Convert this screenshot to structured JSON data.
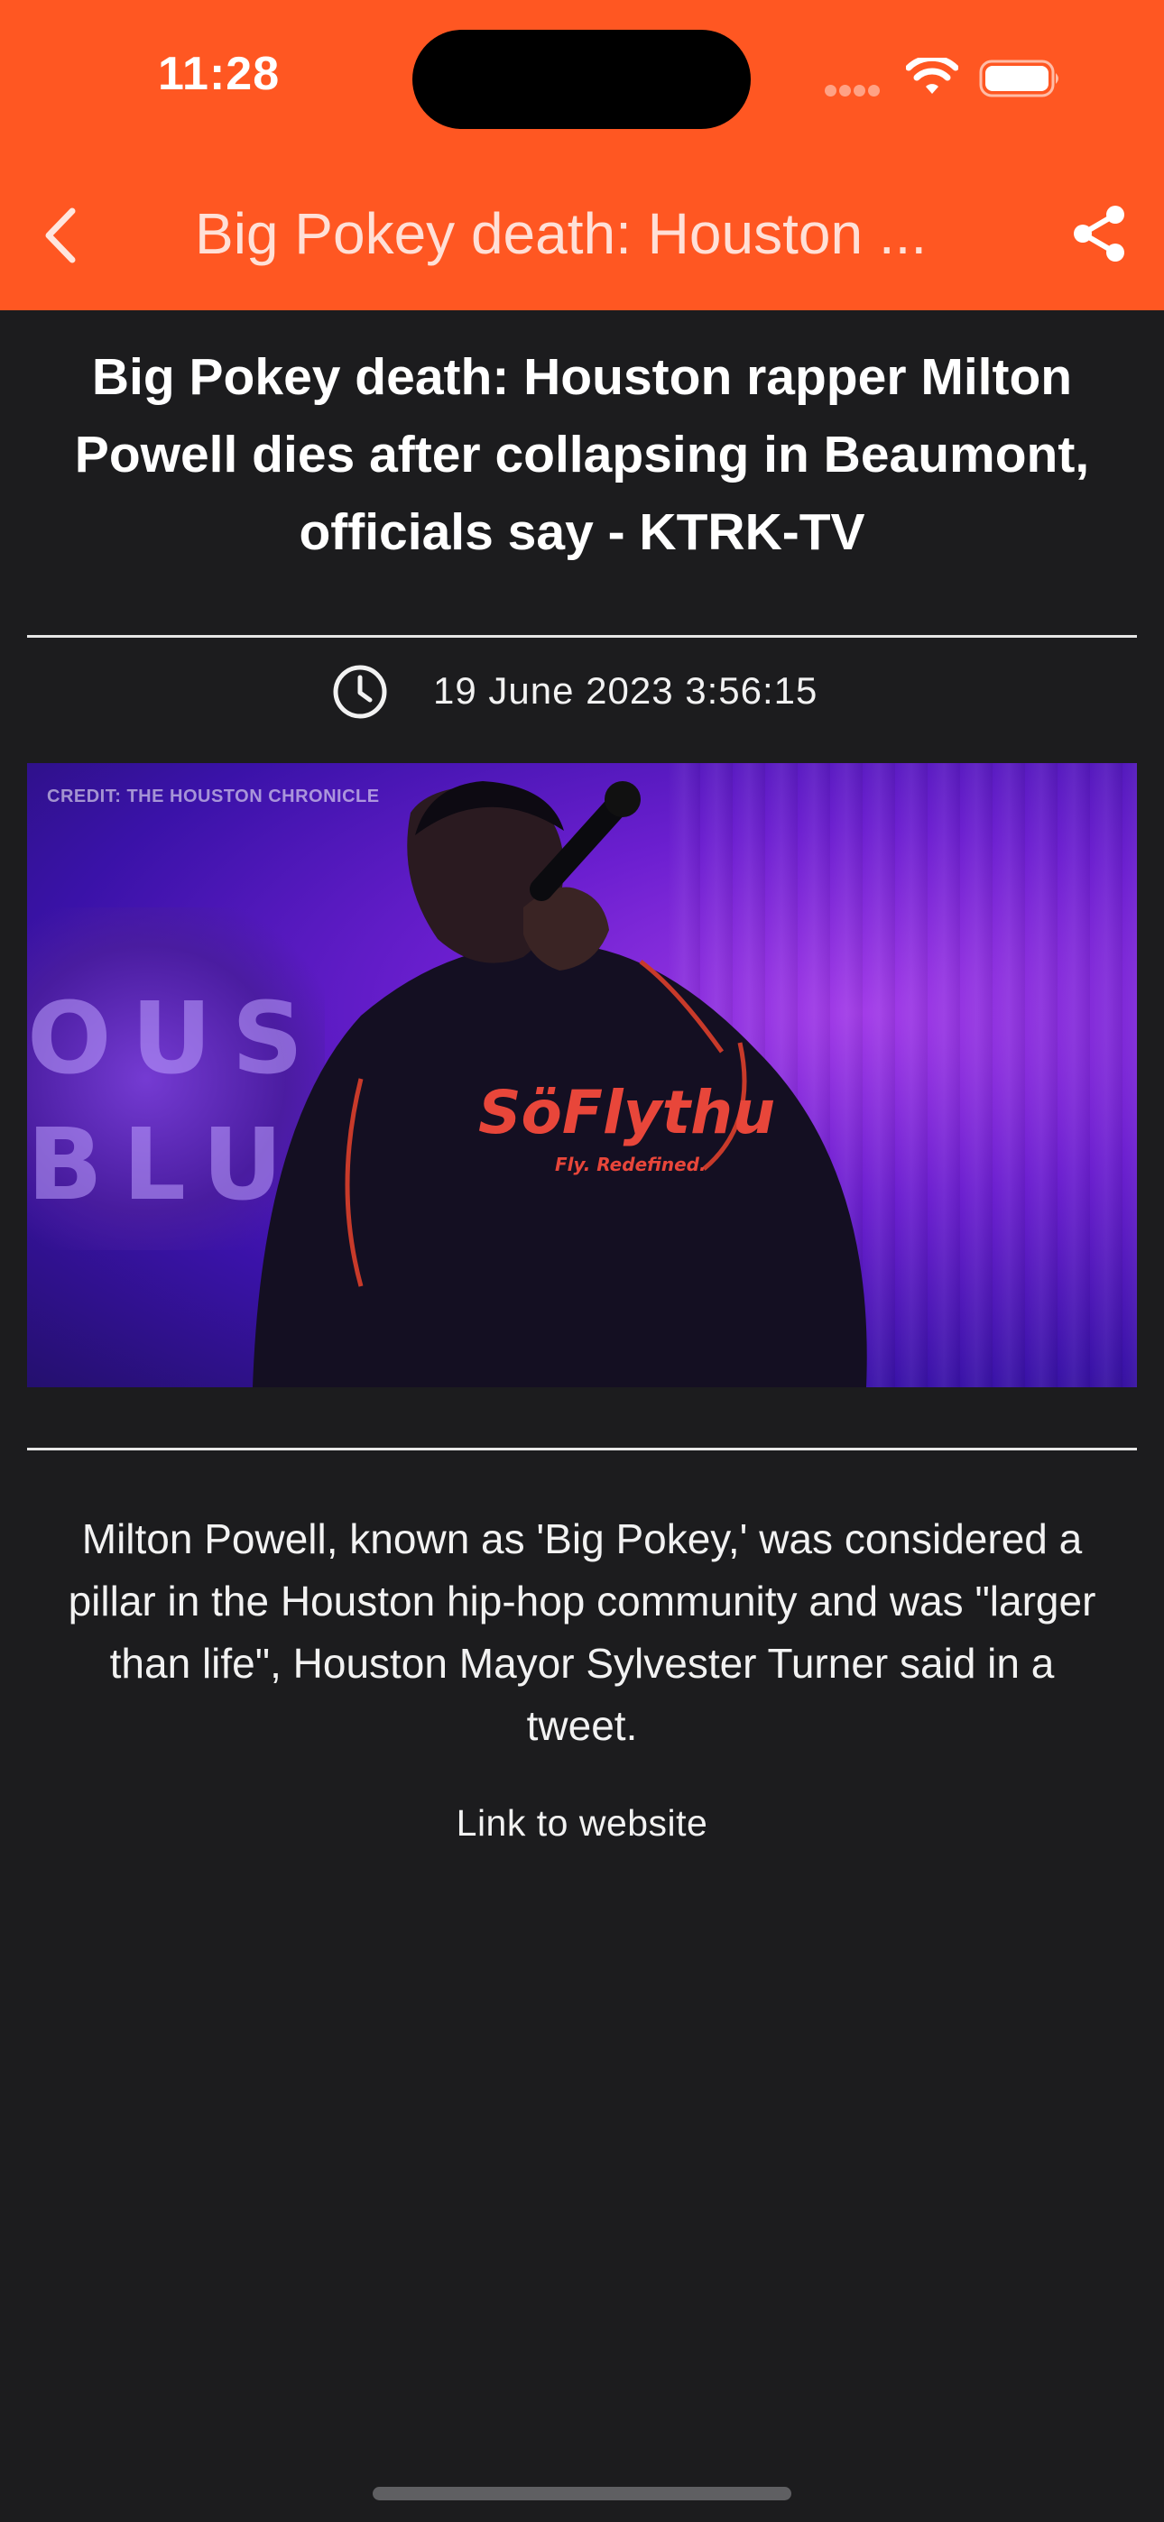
{
  "status_bar": {
    "time": "11:28"
  },
  "nav_bar": {
    "back_icon": "chevron-left-icon",
    "title": "Big Pokey death: Houston ...",
    "share_icon": "share-icon",
    "background_color": "#ff5722"
  },
  "article": {
    "headline": "Big Pokey death: Houston rapper Milton Powell dies after collapsing in Beaumont, officials say - KTRK-TV",
    "date_icon": "clock-icon",
    "date": "19 June 2023 3:56:15",
    "image": {
      "credit": "CREDIT: THE HOUSTON CHRONICLE",
      "sign_letters": "OUS\nBLU",
      "shirt_text": "SöFlythu",
      "shirt_subtext": "Fly. Redefined."
    },
    "summary": "Milton Powell, known as 'Big Pokey,' was considered a pillar in the Houston hip-hop community and was \"larger than life\", Houston Mayor Sylvester Turner said in a tweet.",
    "link_label": "Link to website"
  },
  "colors": {
    "accent": "#ff5722",
    "background": "#1c1c1e",
    "text": "#ffffff"
  }
}
